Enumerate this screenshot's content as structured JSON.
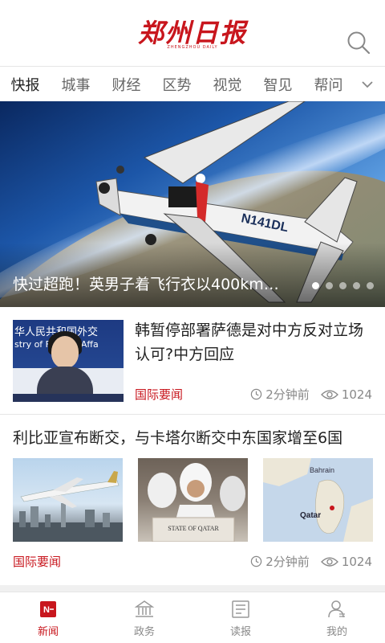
{
  "header": {
    "logo_text": "郑州日报",
    "logo_subtext": "ZHENGZHOU DAILY"
  },
  "tabs": [
    {
      "label": "快报",
      "active": true
    },
    {
      "label": "城事",
      "active": false
    },
    {
      "label": "财经",
      "active": false
    },
    {
      "label": "区势",
      "active": false
    },
    {
      "label": "视觉",
      "active": false
    },
    {
      "label": "智见",
      "active": false
    },
    {
      "label": "帮问",
      "active": false
    }
  ],
  "hero": {
    "caption": "快过超跑！英男子着飞行衣以400km…",
    "plane_reg": "N141DL",
    "slide_count": 5,
    "active_slide": 1
  },
  "news": [
    {
      "title": "韩暂停部署萨德是对中方反对立场认可?中方回应",
      "tag": "国际要闻",
      "time": "2分钟前",
      "views": "1024",
      "thumb_text_1": "华人民共和国外交",
      "thumb_text_2": "stry of Foreign Affa"
    },
    {
      "title": "利比亚宣布断交，与卡塔尔断交中东国家增至6国",
      "tag": "国际要闻",
      "time": "2分钟前",
      "views": "1024",
      "pic2_caption": "STATE OF QATAR",
      "pic3_labels": [
        "Bahrain",
        "Qatar"
      ]
    }
  ],
  "bottom_nav": [
    {
      "label": "新闻",
      "icon": "news-icon",
      "active": true
    },
    {
      "label": "政务",
      "icon": "government-icon",
      "active": false
    },
    {
      "label": "读报",
      "icon": "newspaper-icon",
      "active": false
    },
    {
      "label": "我的",
      "icon": "profile-icon",
      "active": false
    }
  ],
  "colors": {
    "brand_red": "#c8161d",
    "muted_text": "#888888",
    "divider": "#e6e6e6"
  }
}
